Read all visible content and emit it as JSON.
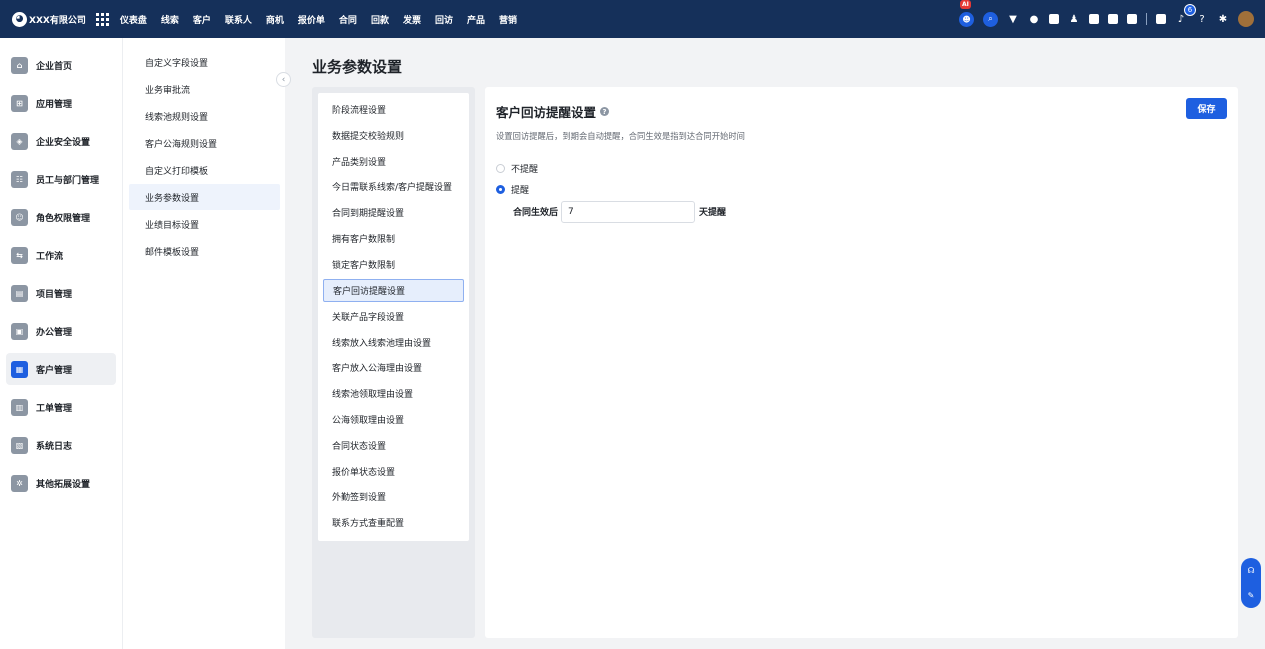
{
  "topbar": {
    "company": "XXX有限公司",
    "nav": [
      "仪表盘",
      "线索",
      "客户",
      "联系人",
      "商机",
      "报价单",
      "合同",
      "回款",
      "发票",
      "回访",
      "产品",
      "营销"
    ],
    "ai_badge": "AI",
    "notification_count": "6"
  },
  "sidebar": {
    "items": [
      {
        "label": "企业首页",
        "icon": "home-icon"
      },
      {
        "label": "应用管理",
        "icon": "apps-icon"
      },
      {
        "label": "企业安全设置",
        "icon": "shield-icon"
      },
      {
        "label": "员工与部门管理",
        "icon": "users-icon"
      },
      {
        "label": "角色权限管理",
        "icon": "user-icon"
      },
      {
        "label": "工作流",
        "icon": "workflow-icon"
      },
      {
        "label": "项目管理",
        "icon": "project-icon"
      },
      {
        "label": "办公管理",
        "icon": "office-icon"
      },
      {
        "label": "客户管理",
        "icon": "customer-icon"
      },
      {
        "label": "工单管理",
        "icon": "ticket-icon"
      },
      {
        "label": "系统日志",
        "icon": "log-icon"
      },
      {
        "label": "其他拓展设置",
        "icon": "extension-icon"
      }
    ],
    "active_index": 8
  },
  "subsidebar": {
    "items": [
      "自定义字段设置",
      "业务审批流",
      "线索池规则设置",
      "客户公海规则设置",
      "自定义打印模板",
      "业务参数设置",
      "业绩目标设置",
      "邮件模板设置"
    ],
    "active_index": 5
  },
  "page": {
    "title": "业务参数设置"
  },
  "menu": {
    "items": [
      "阶段流程设置",
      "数据提交校验规则",
      "产品类别设置",
      "今日需联系线索/客户提醒设置",
      "合同到期提醒设置",
      "拥有客户数限制",
      "锁定客户数限制",
      "客户回访提醒设置",
      "关联产品字段设置",
      "线索放入线索池理由设置",
      "客户放入公海理由设置",
      "线索池领取理由设置",
      "公海领取理由设置",
      "合同状态设置",
      "报价单状态设置",
      "外勤签到设置",
      "联系方式查重配置"
    ],
    "active_index": 7
  },
  "content": {
    "title": "客户回访提醒设置",
    "description": "设置回访提醒后，到期会自动提醒，合同生效是指到达合同开始时间",
    "save_label": "保存",
    "options": [
      "不提醒",
      "提醒"
    ],
    "selected_option": 1,
    "after_label": "合同生效后",
    "days_value": "7",
    "unit_label": "天提醒"
  },
  "colors": {
    "topbar": "#15305a",
    "accent": "#1e5fe0"
  }
}
